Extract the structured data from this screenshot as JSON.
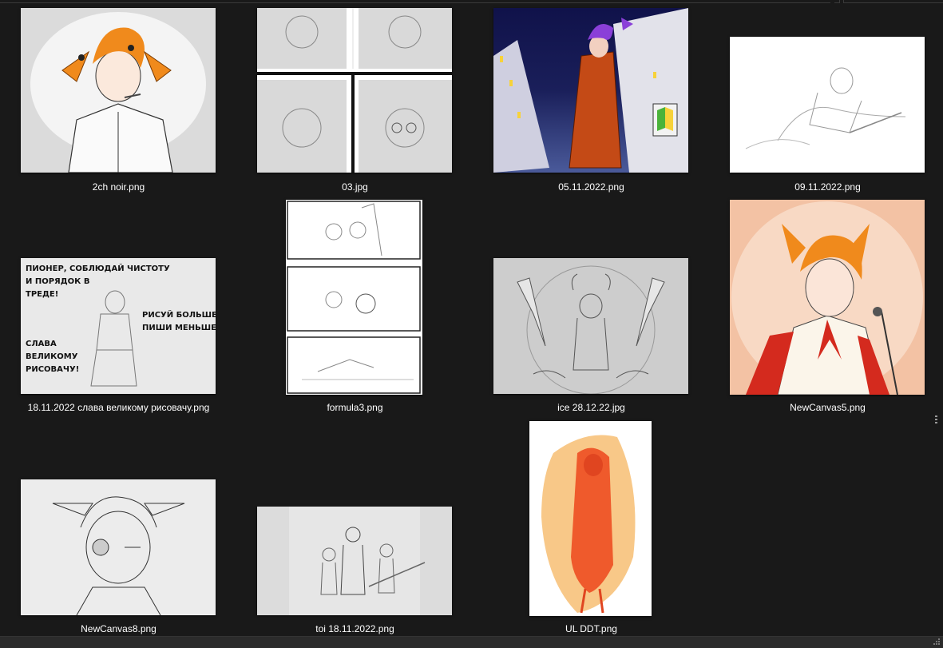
{
  "files": [
    {
      "name": "2ch noir.png"
    },
    {
      "name": "03.jpg"
    },
    {
      "name": "05.11.2022.png"
    },
    {
      "name": "09.11.2022.png"
    },
    {
      "name": "18.11.2022 слава великому рисовачу.png"
    },
    {
      "name": "formula3.png"
    },
    {
      "name": "ice 28.12.22.jpg"
    },
    {
      "name": "NewCanvas5.png"
    },
    {
      "name": "NewCanvas8.png"
    },
    {
      "name": "toi 18.11.2022.png"
    },
    {
      "name": "UL DDT.png"
    }
  ],
  "poster_text": {
    "line1": "ПИОНЕР, СОБЛЮДАЙ ЧИСТОТУ",
    "line2": "И ПОРЯДОК В",
    "line3": "ТРЕДЕ!",
    "line4": "РИСУЙ БОЛЬШЕ –",
    "line5": "ПИШИ МЕНЬШЕ!",
    "line6": "СЛАВА",
    "line7": "ВЕЛИКОМУ",
    "line8": "РИСОВАЧУ!"
  },
  "colors": {
    "background": "#191919",
    "label_text": "#ffffff",
    "orange_hair": "#f08a1c",
    "night_sky": "#1a1f5a"
  }
}
